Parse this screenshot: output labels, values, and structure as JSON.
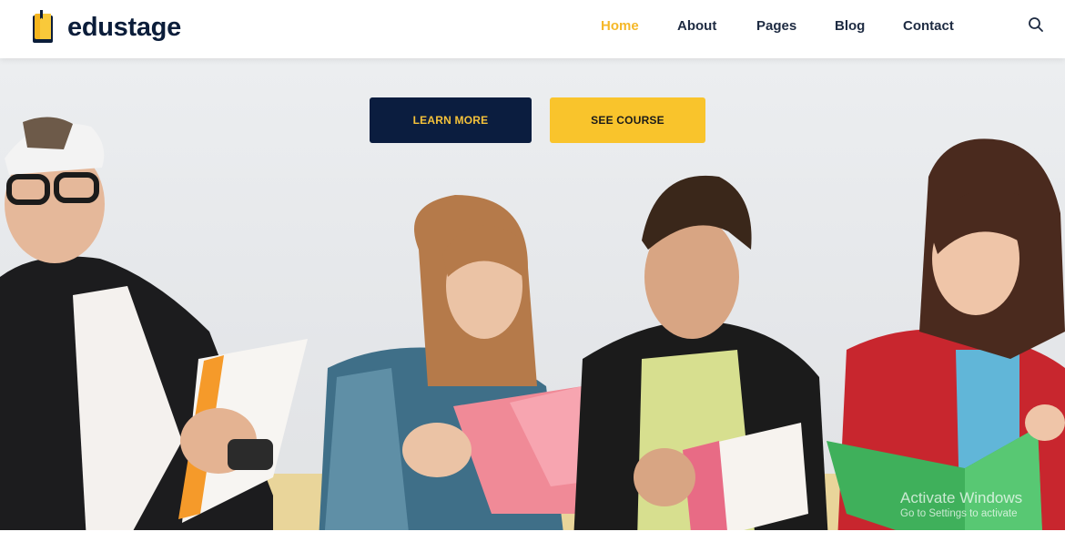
{
  "header": {
    "logo_text": "edustage",
    "logo_icon": "book-icon",
    "nav": [
      {
        "label": "Home",
        "active": true
      },
      {
        "label": "About",
        "active": false
      },
      {
        "label": "Pages",
        "active": false
      },
      {
        "label": "Blog",
        "active": false
      },
      {
        "label": "Contact",
        "active": false
      }
    ],
    "search_icon": "search-icon"
  },
  "hero": {
    "learn_more_label": "LEARN MORE",
    "see_course_label": "SEE COURSE",
    "image_subject": "students reading notebooks"
  },
  "watermark": {
    "title": "Activate Windows",
    "subtitle": "Go to Settings to activate"
  },
  "colors": {
    "accent": "#f5b829",
    "navy": "#0b1d3f",
    "nav_text": "#1e2b42"
  }
}
